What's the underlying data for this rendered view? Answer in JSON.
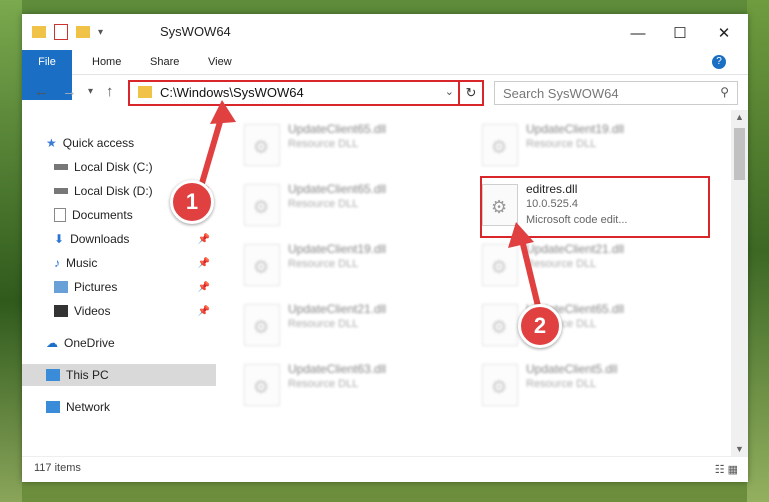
{
  "window": {
    "title": "SysWOW64",
    "buttons": {
      "minimize": "—",
      "maximize": "☐",
      "close": "✕"
    }
  },
  "ribbon": {
    "tabs": [
      "File",
      "Home",
      "Share",
      "View"
    ],
    "help": "?"
  },
  "address": {
    "path": "C:\\Windows\\SysWOW64",
    "search_placeholder": "Search SysWOW64"
  },
  "nav": {
    "items": [
      {
        "label": "Quick access"
      },
      {
        "label": "Local Disk (C:)"
      },
      {
        "label": "Local Disk (D:)"
      },
      {
        "label": "Documents"
      },
      {
        "label": "Downloads"
      },
      {
        "label": "Music"
      },
      {
        "label": "Pictures"
      },
      {
        "label": "Videos"
      },
      {
        "label": "OneDrive"
      },
      {
        "label": "This PC"
      },
      {
        "label": "Network"
      }
    ]
  },
  "files": {
    "col1": [
      {
        "name": "UpdateClient65.dll",
        "type": "Resource DLL"
      },
      {
        "name": "UpdateClient65.dll",
        "type": "Resource DLL"
      },
      {
        "name": "UpdateClient19.dll",
        "type": "Resource DLL"
      },
      {
        "name": "UpdateClient21.dll",
        "type": "Resource DLL"
      },
      {
        "name": "UpdateClient63.dll",
        "type": "Resource DLL"
      }
    ],
    "col2": [
      {
        "name": "UpdateClient19.dll",
        "type": "Resource DLL"
      },
      {
        "name": "editres.dll",
        "version": "10.0.525.4",
        "desc": "Microsoft code edit..."
      },
      {
        "name": "UpdateClient21.dll",
        "type": "Resource DLL"
      },
      {
        "name": "UpdateClient65.dll",
        "type": "Resource DLL"
      },
      {
        "name": "UpdateClient5.dll",
        "type": "Resource DLL"
      }
    ]
  },
  "status": {
    "item_count": "117 items"
  },
  "callouts": {
    "one": "1",
    "two": "2"
  },
  "colors": {
    "accent": "#1a6ec4",
    "highlight": "#d9262b"
  }
}
